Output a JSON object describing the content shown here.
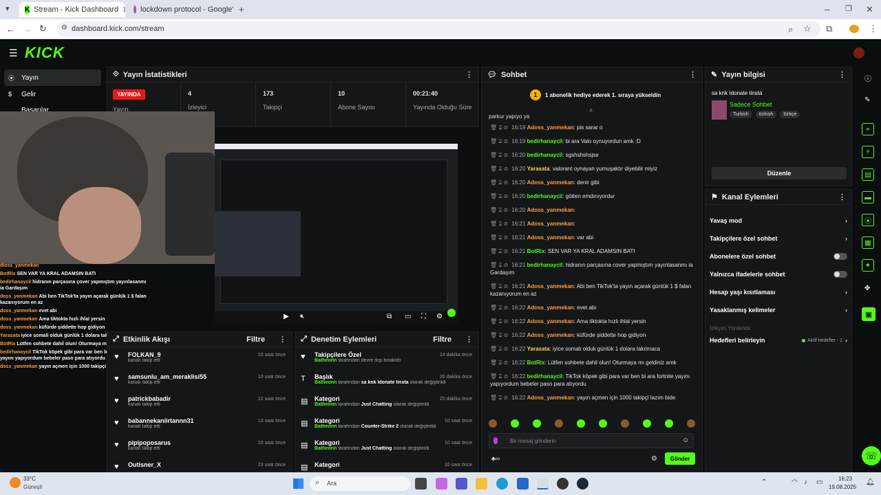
{
  "browser": {
    "tabs": [
      {
        "title": "Stream - Kick Dashboard"
      },
      {
        "title": "lockdown protocol - Google'da"
      }
    ],
    "url": "dashboard.kick.com/stream"
  },
  "sidebar": {
    "logo": "KICK",
    "items": [
      {
        "label": "Yayın"
      },
      {
        "label": "Gelir"
      },
      {
        "label": "Başarılar"
      }
    ]
  },
  "stats": {
    "title": "Yayın İstatistikleri",
    "live_badge": "YAYINDA",
    "live_label": "Yayın",
    "items": [
      {
        "value": "4",
        "label": "İzleyici"
      },
      {
        "value": "173",
        "label": "Takipçi"
      },
      {
        "value": "10",
        "label": "Abone Sayısı"
      },
      {
        "value": "00:21:40",
        "label": "Yayında Olduğu Süre"
      }
    ]
  },
  "activity": {
    "title": "Etkinlik Akışı",
    "filter": "Filtre",
    "items": [
      {
        "name": "FOLKAN_9",
        "sub": "kanalı takip etti",
        "time": "10 saat önce"
      },
      {
        "name": "samsunlu_am_meraklisi55",
        "sub": "kanalı takip etti",
        "time": "10 saat önce"
      },
      {
        "name": "patrickbabadir",
        "sub": "kanalı takip etti",
        "time": "12 saat önce"
      },
      {
        "name": "babannekaniirtannn31",
        "sub": "kanalı takip etti",
        "time": "13 saat önce"
      },
      {
        "name": "pipipoposarus",
        "sub": "kanalı takip etti",
        "time": "23 saat önce"
      },
      {
        "name": "Outisner_X",
        "sub": "",
        "time": "23 saat önce"
      }
    ]
  },
  "moderation": {
    "title": "Denetim Eylemleri",
    "filter": "Filtre",
    "items": [
      {
        "title": "Takipçilere Özel",
        "actor": "Batheonn",
        "pre": "tarafından",
        "mid": "devre dışı bırakıldı",
        "target": "",
        "time": "14 dakika önce"
      },
      {
        "title": "Başlık",
        "actor": "Batheonn",
        "pre": "tarafından",
        "target": "sa knk Idonate Iinsta",
        "mid": "olarak değiştirildi",
        "time": "20 dakika önce"
      },
      {
        "title": "Kategori",
        "actor": "Batheonn",
        "pre": "tarafından",
        "target": "Just Chatting",
        "mid": "olarak değiştirildi",
        "time": "20 dakika önce"
      },
      {
        "title": "Kategori",
        "actor": "Batheonn",
        "pre": "tarafından",
        "target": "Counter-Strike 2",
        "mid": "olarak değiştirildi",
        "time": "10 saat önce"
      },
      {
        "title": "Kategori",
        "actor": "Batheonn",
        "pre": "tarafından",
        "target": "Just Chatting",
        "mid": "olarak değiştirildi",
        "time": "10 saat önce"
      },
      {
        "title": "Kategori",
        "actor": "",
        "pre": "",
        "target": "",
        "mid": "",
        "time": "10 saat önce"
      }
    ]
  },
  "chat": {
    "title": "Sohbet",
    "pinned": "1 abonelik hediye ederek 1. sıraya yükseldin",
    "top_line": "parkur yapıyo ya",
    "placeholder": "Bir mesaj gönderin",
    "send": "Gönder",
    "messages": [
      {
        "time": "16:19",
        "user": "Adoss_yanmekan",
        "c": "u1",
        "text": "pis sarar o"
      },
      {
        "time": "16:19",
        "user": "bedirhanaycil",
        "c": "u2",
        "text": "bi ara Valo oynuyordun amk :D"
      },
      {
        "time": "16:20",
        "user": "bedirhanaycil",
        "c": "u2",
        "text": "sgshshshsjse"
      },
      {
        "time": "16:20",
        "user": "Yarasata",
        "c": "u3",
        "text": "valorant oynayan yumuşaktır diyebilir miyiz"
      },
      {
        "time": "16:20",
        "user": "Adoss_yanmekan",
        "c": "u1",
        "text": "denir gibi"
      },
      {
        "time": "16:20",
        "user": "bedirhanaycil",
        "c": "u2",
        "text": "götten emdınıyordur"
      },
      {
        "time": "16:20",
        "user": "Adoss_yanmekan",
        "c": "u1",
        "text": ""
      },
      {
        "time": "16:21",
        "user": "Adoss_yanmekan",
        "c": "u1",
        "text": ""
      },
      {
        "time": "16:21",
        "user": "Adoss_yanmekan",
        "c": "u1",
        "text": "var abi"
      },
      {
        "time": "16:21",
        "user": "BotRix",
        "c": "u2",
        "text": "SEN VAR YA KRAL ADAMSIN BATI"
      },
      {
        "time": "16:21",
        "user": "bedirhanaycil",
        "c": "u2",
        "text": "hidranın parçasına cover yapmıştım yayınlasanmı ia Gardaşım"
      },
      {
        "time": "16:21",
        "user": "Adoss_yanmekan",
        "c": "u1",
        "text": "Abi ben TikTok'ta yayın açarak günlük 1 $ falan kazanıyorum en az"
      },
      {
        "time": "16:22",
        "user": "Adoss_yanmekan",
        "c": "u1",
        "text": "evet abi"
      },
      {
        "time": "16:22",
        "user": "Adoss_yanmekan",
        "c": "u1",
        "text": "Ama tiktokta hızlı ihlal yersin"
      },
      {
        "time": "16:22",
        "user": "Adoss_yanmekan",
        "c": "u1",
        "text": "küfürde şiddette hop gidiyon"
      },
      {
        "time": "16:22",
        "user": "Yarasata",
        "c": "u3",
        "text": "iyice somali olduk günlük 1 dolara takılmaca"
      },
      {
        "time": "16:22",
        "user": "BotRix",
        "c": "u2",
        "text": "Lütfen sohbete dahil olun! Oturmaya mı geldiniz amk"
      },
      {
        "time": "16:22",
        "user": "bedirhanaycil",
        "c": "u2",
        "text": "TikTok köpek gibi para var ben bi ara fortnite yayını yapıyordum bebeler paso para atıyordu"
      },
      {
        "time": "16:22",
        "user": "Adoss_yanmekan",
        "c": "u1",
        "text": "yayın açmen için 1000 takipçi lazım bide"
      }
    ]
  },
  "info": {
    "title": "Yayın bilgisi",
    "stream_title": "sa knk Idonate Iinsta",
    "category": "Sadece Sohbet",
    "tags": [
      "Turkish",
      "türkish",
      "türkçe"
    ],
    "edit": "Düzenle"
  },
  "channel": {
    "title": "Kanal Eylemleri",
    "items": [
      {
        "label": "Yavaş mod",
        "type": "chev"
      },
      {
        "label": "Takipçilere özel sohbet",
        "type": "chev"
      },
      {
        "label": "Abonelere özel sohbet",
        "type": "toggle"
      },
      {
        "label": "Yalnızca ifadelerle sohbet",
        "type": "toggle"
      },
      {
        "label": "Hesap yaşı kısıtlaması",
        "type": "chev"
      },
      {
        "label": "Yasaklanmış kelimeler",
        "type": "chev"
      },
      {
        "label": "İzleyici Yönlendir",
        "type": "dim"
      }
    ],
    "goals_label": "Hedefleri belirleyin",
    "goals_status": "Aktif hedefler - 1"
  },
  "overlay_chat": [
    {
      "user": "dioss_yanmekan",
      "text": ""
    },
    {
      "user": "BotRix",
      "text": "SEN VAR YA KRAL ADAMSIN BATI"
    },
    {
      "user": "bedirhanaycil",
      "text": "hidranın parçasına çover yapmıştım yayınlasanmı ia Gardaşım"
    },
    {
      "user": "doss_yanmekan",
      "text": "Abi ben TikTok'ta yayın açarak günlük 1 $ falan kazanıyorum en az"
    },
    {
      "user": "doss_yanmekan",
      "text": "evet abi"
    },
    {
      "user": "doss_yanmekan",
      "text": "Ama tiktokta hızlı ihlal yersin"
    },
    {
      "user": "doss_yanmekan",
      "text": "küfürde şiddette hop gidiyon"
    },
    {
      "user": "Yarasata",
      "text": "iyice somali olduk günlük 1 dolara takılmaca"
    },
    {
      "user": "BotRix",
      "text": "Lütfen sohbete dahil olun! Oturmaya mı geldiniz amk"
    },
    {
      "user": "bedirhanaycil",
      "text": "TikTok köpek gibi para var ben bi ara fortnite yayını yapıyordum bebeler paso para atıyordu"
    },
    {
      "user": "doss_yanmekan",
      "text": "yayın açmen için 1000 takipçi lazım bide"
    }
  ],
  "taskbar": {
    "temp": "33°C",
    "weather": "Güneşli",
    "search": "Ara",
    "time": "16:23",
    "date": "19.08.2025"
  },
  "colors": {
    "accent": "#53fc18",
    "live": "#e91916"
  }
}
